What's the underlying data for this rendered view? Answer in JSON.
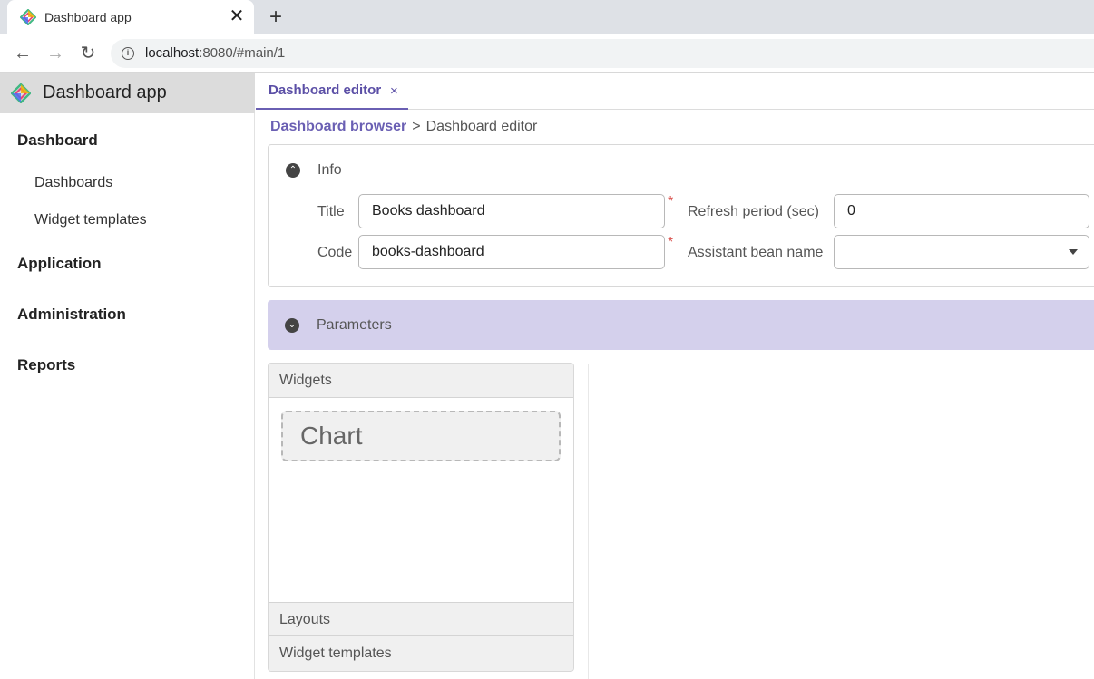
{
  "browser": {
    "tab_title": "Dashboard app",
    "close_glyph": "✕",
    "new_tab_glyph": "+",
    "back_glyph": "←",
    "forward_glyph": "→",
    "reload_glyph": "↻",
    "info_glyph": "i",
    "url_host": "localhost",
    "url_rest": ":8080/#main/1"
  },
  "sidebar": {
    "app_title": "Dashboard app",
    "items": [
      {
        "label": "Dashboard"
      },
      {
        "label": "Dashboards"
      },
      {
        "label": "Widget templates"
      },
      {
        "label": "Application"
      },
      {
        "label": "Administration"
      },
      {
        "label": "Reports"
      }
    ]
  },
  "main": {
    "tab": {
      "label": "Dashboard editor",
      "close": "×"
    },
    "breadcrumb": {
      "link": "Dashboard browser",
      "separator": ">",
      "current": "Dashboard editor"
    },
    "info": {
      "title": "Info",
      "toggle_glyph": "⌃",
      "fields": {
        "title_label": "Title",
        "title_value": "Books dashboard",
        "code_label": "Code",
        "code_value": "books-dashboard",
        "refresh_label": "Refresh period (sec)",
        "refresh_value": "0",
        "bean_label": "Assistant bean name",
        "bean_value": "",
        "required_mark": "*"
      }
    },
    "parameters": {
      "title": "Parameters",
      "toggle_glyph": "⌄"
    },
    "palette": {
      "widgets_header": "Widgets",
      "chart_tile": "Chart",
      "layouts_header": "Layouts",
      "templates_header": "Widget templates"
    }
  },
  "colors": {
    "accent": "#6a5fb3",
    "parameters_bg": "#d4d0ec",
    "required": "#d9534f"
  },
  "icons": [
    "jmix-logo-icon",
    "close-icon",
    "plus-icon",
    "back-arrow-icon",
    "forward-arrow-icon",
    "reload-icon",
    "info-icon",
    "chevron-up-icon",
    "chevron-down-icon",
    "caret-down-icon"
  ]
}
